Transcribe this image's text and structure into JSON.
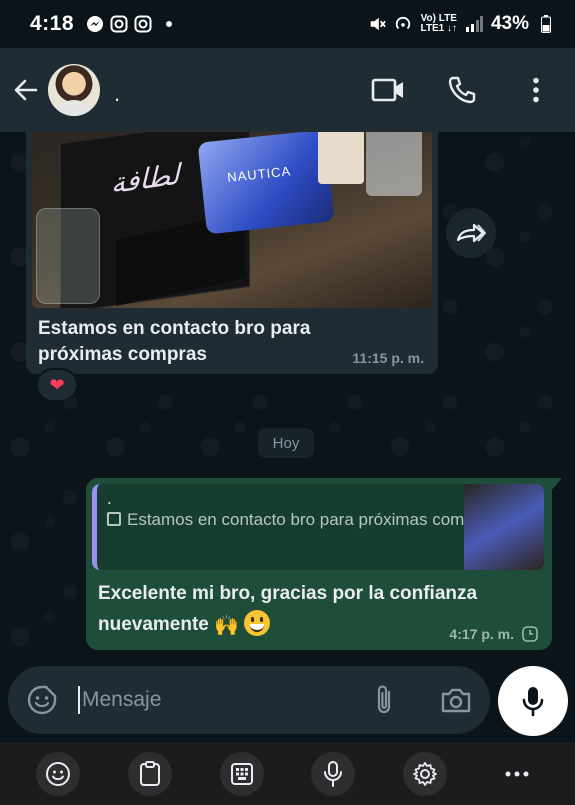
{
  "status_bar": {
    "time": "4:18",
    "network_line1": "Vo) LTE",
    "network_line2": "LTE1 ↓↑",
    "battery": "43%"
  },
  "header": {
    "contact_name": "."
  },
  "messages": {
    "incoming": {
      "caption": "Estamos en contacto bro para próximas compras",
      "time": "11:15 p. m.",
      "reaction": "❤"
    },
    "day_divider": "Hoy",
    "outgoing": {
      "quote_author": ".",
      "quote_text": "Estamos en contacto bro para próximas compras",
      "text": "Excelente mi bro, gracias por la confianza nuevamente",
      "hands_emoji": "🙌",
      "time": "4:17 p. m."
    }
  },
  "composer": {
    "placeholder": "Mensaje"
  },
  "colors": {
    "background": "#0b141a",
    "header": "#1f2c34",
    "incoming_bubble": "#1f2c34",
    "outgoing_bubble": "#1e4d3a",
    "quote_bar": "#9a8ff0"
  },
  "icons": [
    "back-arrow-icon",
    "video-call-icon",
    "voice-call-icon",
    "more-options-icon",
    "forward-icon",
    "emoji-icon",
    "attach-icon",
    "camera-icon",
    "mic-icon",
    "clock-icon",
    "clipboard-icon",
    "keypad-icon",
    "settings-icon"
  ]
}
